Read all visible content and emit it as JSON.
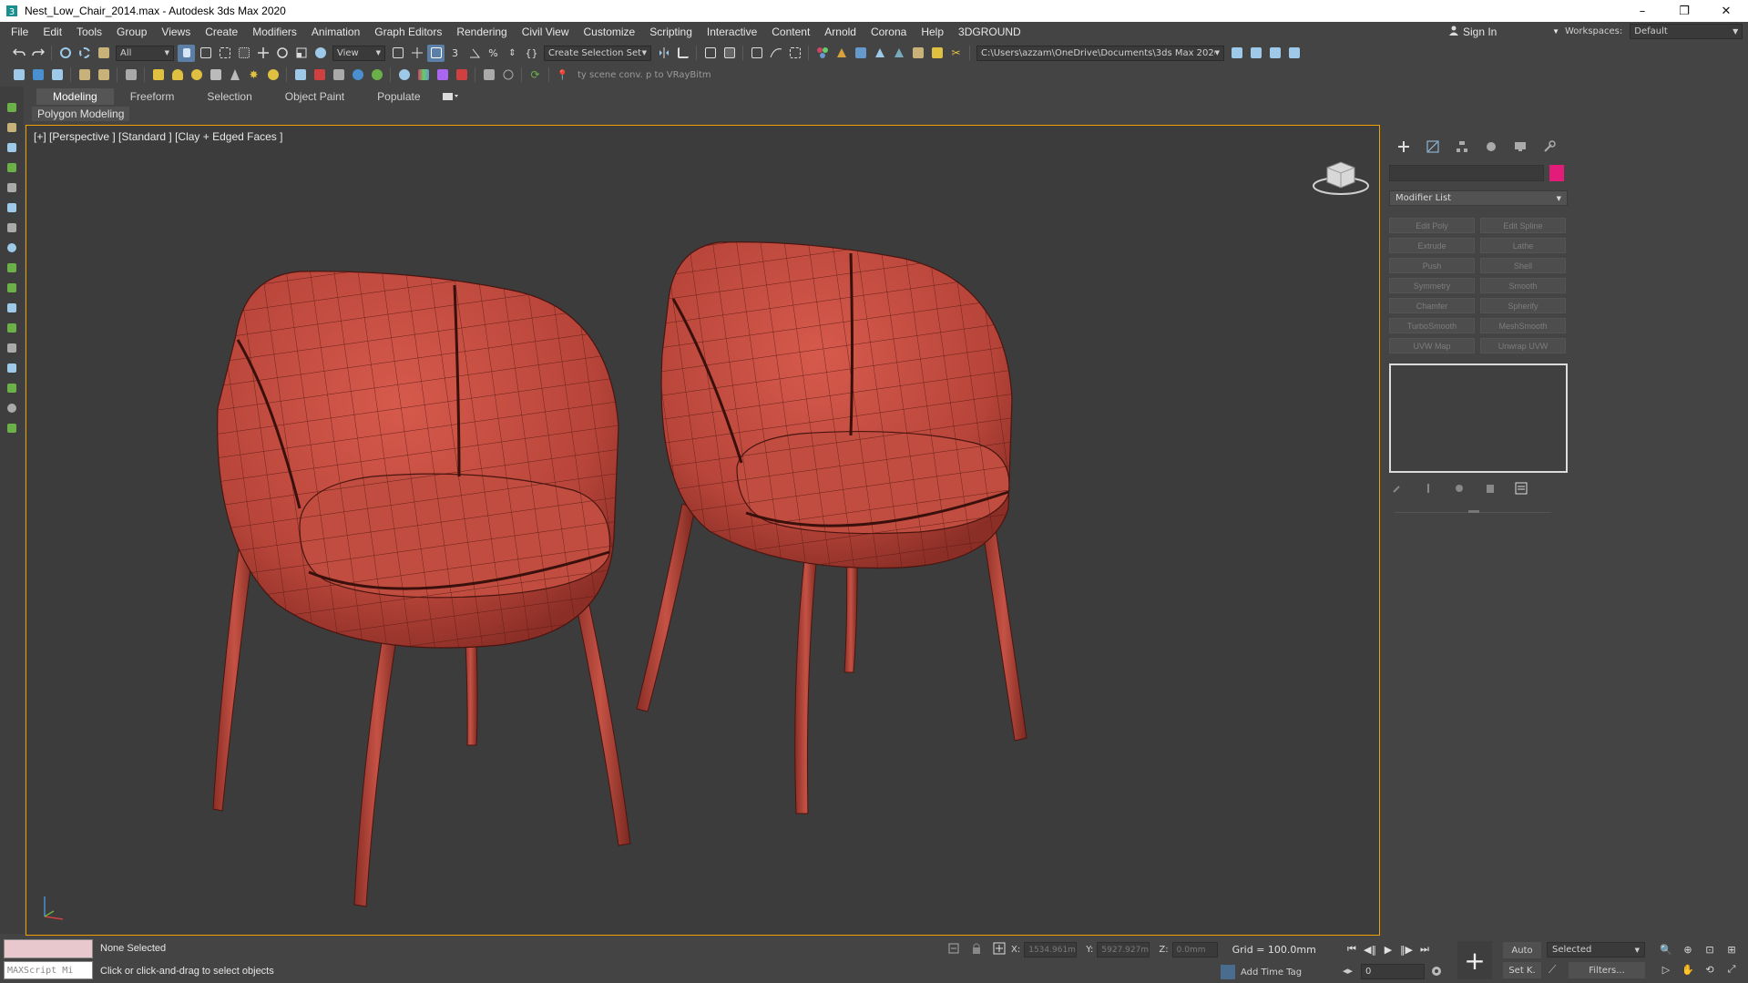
{
  "window": {
    "title": "Nest_Low_Chair_2014.max - Autodesk 3ds Max 2020",
    "minimize": "–",
    "maximize": "❐",
    "close": "✕"
  },
  "menu": {
    "items": [
      "File",
      "Edit",
      "Tools",
      "Group",
      "Views",
      "Create",
      "Modifiers",
      "Animation",
      "Graph Editors",
      "Rendering",
      "Civil View",
      "Customize",
      "Scripting",
      "Interactive",
      "Content",
      "Arnold",
      "Corona",
      "Help",
      "3DGROUND"
    ],
    "sign_in": "Sign In",
    "workspaces_label": "Workspaces:",
    "workspaces_value": "Default"
  },
  "toolbar": {
    "selection_filter": "All",
    "reference_coord": "View",
    "selection_set": "Create Selection Set",
    "project_path": "C:\\Users\\azzam\\OneDrive\\Documents\\3ds Max 2020",
    "scene_converter_hint": "ty scene conv. p to VRayBitm"
  },
  "ribbon": {
    "tabs": [
      "Modeling",
      "Freeform",
      "Selection",
      "Object Paint",
      "Populate"
    ],
    "active_tab": "Modeling",
    "panel": "Polygon Modeling"
  },
  "viewport": {
    "label": "[+] [Perspective ] [Standard ] [Clay + Edged Faces ]",
    "border_color": "#f0a000",
    "object_color": "#b8453a",
    "wire_color": "#5a1a14"
  },
  "command_panel": {
    "object_color": "#e31c7a",
    "modifier_list": "Modifier List",
    "modifier_buttons": [
      "Edit Poly",
      "Edit Spline",
      "Extrude",
      "Lathe",
      "Push",
      "Shell",
      "Symmetry",
      "Smooth",
      "Chamfer",
      "Spherify",
      "TurboSmooth",
      "MeshSmooth",
      "UVW Map",
      "Unwrap UVW"
    ]
  },
  "status": {
    "maxscript_placeholder": "MAXScript Mi",
    "selection": "None Selected",
    "prompt": "Click or click-and-drag to select objects",
    "x_label": "X:",
    "x_value": "1534.961m",
    "y_label": "Y:",
    "y_value": "5927.927m",
    "z_label": "Z:",
    "z_value": "0.0mm",
    "grid": "Grid = 100.0mm",
    "add_time_tag": "Add Time Tag",
    "frame": "0",
    "auto_key": "Auto",
    "set_key": "Set K.",
    "key_filter": "Selected",
    "filters": "Filters..."
  }
}
